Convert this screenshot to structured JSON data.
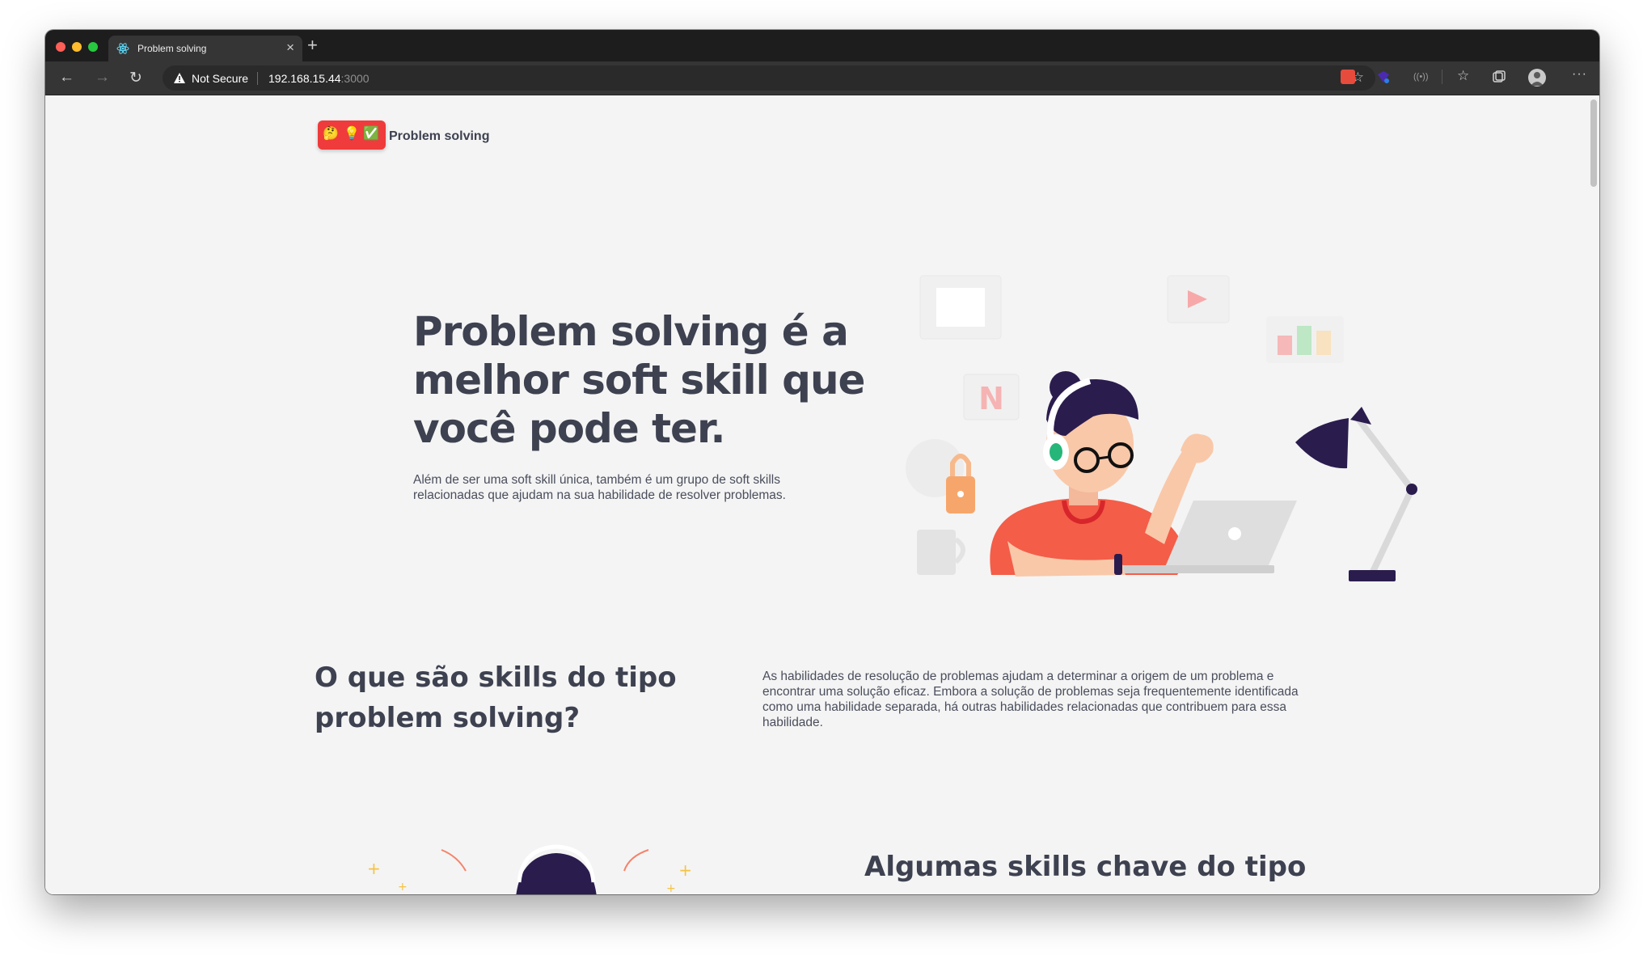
{
  "browser": {
    "tab_title": "Problem solving",
    "tab_close": "×",
    "new_tab": "+",
    "security_label": "Not Secure",
    "url_host": "192.168.15.44",
    "url_port": ":3000"
  },
  "site": {
    "logo_emojis": [
      "🤔",
      "💡",
      "✅"
    ],
    "brand_name": "Problem solving",
    "hero": {
      "title": "Problem solving é a melhor soft skill que você pode ter.",
      "subtitle": "Além de ser uma soft skill única, também é um grupo de soft skills relacionadas que ajudam na sua habilidade de resolver problemas."
    },
    "section_what": {
      "title": "O que são skills do tipo problem solving?",
      "text": "As habilidades de resolução de problemas ajudam a determinar a origem de um problema e encontrar uma solução eficaz. Embora a solução de problemas seja frequentemente identificada como uma habilidade separada, há outras habilidades relacionadas que contribuem para essa habilidade."
    },
    "section_key": {
      "title": "Algumas skills chave do tipo"
    }
  },
  "colors": {
    "text_primary": "#3d4150",
    "accent_red": "#ef3b3b",
    "page_bg": "#f4f4f4"
  },
  "icons": [
    "react-icon",
    "warning-icon",
    "star-icon",
    "favorites-icon",
    "collections-icon",
    "profile-icon",
    "more-icon"
  ]
}
